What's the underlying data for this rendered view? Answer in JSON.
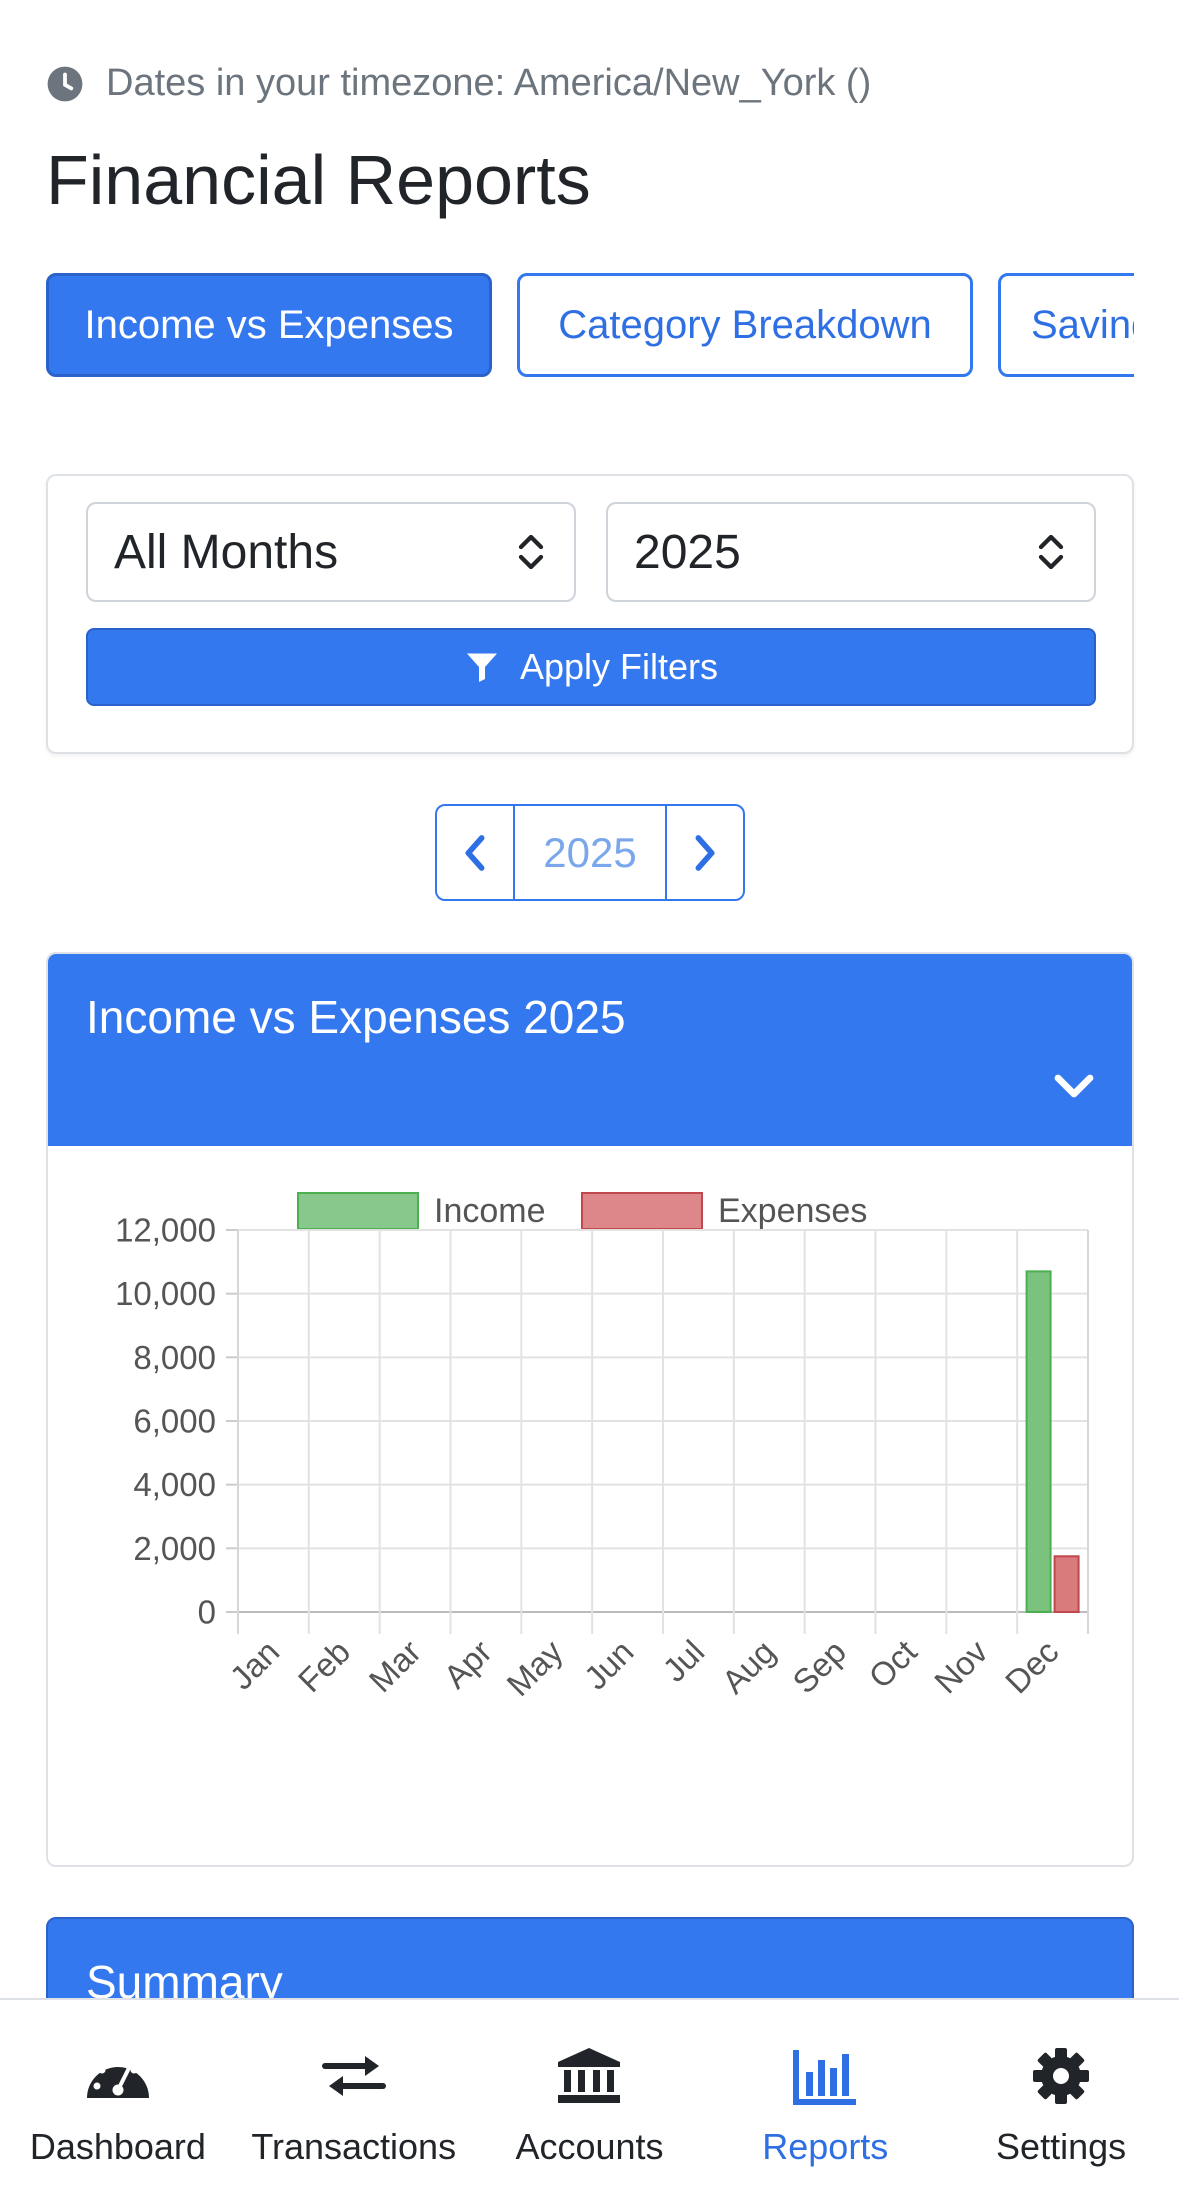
{
  "timezone_note": "Dates in your timezone: America/New_York ()",
  "page_title": "Financial Reports",
  "tabs": [
    {
      "label": "Income vs Expenses",
      "active": true
    },
    {
      "label": "Category Breakdown",
      "active": false
    },
    {
      "label": "Savings",
      "active": false
    }
  ],
  "filters": {
    "month_select": "All Months",
    "year_select": "2025",
    "apply_label": "Apply Filters"
  },
  "pager": {
    "year": "2025"
  },
  "chart_card": {
    "title": "Income vs Expenses 2025"
  },
  "summary_card": {
    "title": "Summary"
  },
  "colors": {
    "primary": "#3478f0",
    "income": "#7cc27f",
    "expenses": "#d97a7d"
  },
  "chart_data": {
    "type": "bar",
    "categories": [
      "Jan",
      "Feb",
      "Mar",
      "Apr",
      "May",
      "Jun",
      "Jul",
      "Aug",
      "Sep",
      "Oct",
      "Nov",
      "Dec"
    ],
    "series": [
      {
        "name": "Income",
        "values": [
          0,
          0,
          0,
          0,
          0,
          0,
          0,
          0,
          0,
          0,
          0,
          10700
        ],
        "color": "#7cc27f"
      },
      {
        "name": "Expenses",
        "values": [
          0,
          0,
          0,
          0,
          0,
          0,
          0,
          0,
          0,
          0,
          0,
          1750
        ],
        "color": "#d97a7d"
      }
    ],
    "yticks": [
      "0",
      "2,000",
      "4,000",
      "6,000",
      "8,000",
      "10,000",
      "12,000"
    ],
    "ylim": [
      0,
      12000
    ],
    "grid": true,
    "legend": "top"
  },
  "bottom_nav": [
    {
      "label": "Dashboard",
      "icon": "gauge-icon",
      "active": false
    },
    {
      "label": "Transactions",
      "icon": "exchange-icon",
      "active": false
    },
    {
      "label": "Accounts",
      "icon": "bank-icon",
      "active": false
    },
    {
      "label": "Reports",
      "icon": "chart-bar-icon",
      "active": true
    },
    {
      "label": "Settings",
      "icon": "gear-icon",
      "active": false
    }
  ]
}
